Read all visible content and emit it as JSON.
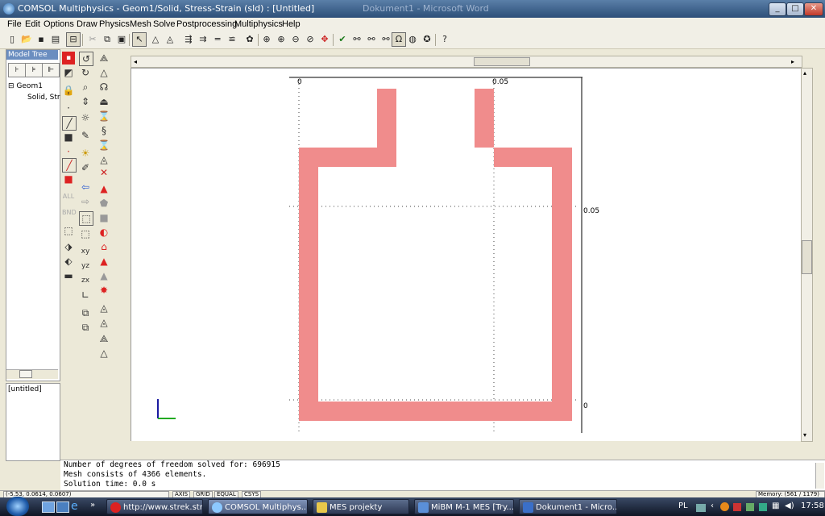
{
  "window": {
    "title": "COMSOL Multiphysics - Geom1/Solid, Stress-Strain (sld) : [Untitled]",
    "bg_title": "Dokument1 - Microsoft Word"
  },
  "menu": [
    "File",
    "Edit",
    "Options",
    "Draw",
    "Physics",
    "Mesh",
    "Solve",
    "Postprocessing",
    "Multiphysics",
    "Help"
  ],
  "model_tree": {
    "header": "Model Tree",
    "geom": "Geom1",
    "physics": "Solid, Str",
    "bottom_label": "[untitled]"
  },
  "axes": {
    "x_tick_0": "0",
    "x_tick_1": "0.05",
    "y_tick_0": "0",
    "y_tick_1": "0.05"
  },
  "geometry": {
    "color": "#f08c8c",
    "xlim": [
      0,
      0.075
    ],
    "ylim": [
      0,
      0.09
    ]
  },
  "messages": [
    "Number of degrees of freedom solved for: 696915",
    "Mesh consists of 4366 elements.",
    "Solution time: 0.0 s"
  ],
  "status": {
    "coords": "(-5.53, 0.0614, 0.0607)",
    "axis": "AXIS",
    "grid": "GRID",
    "equal": "EQUAL",
    "csys": "CSYS",
    "memory": "Memory: (561 / 1179)"
  },
  "taskbar": {
    "tasks": [
      "http://www.strek.str...",
      "COMSOL Multiphys...",
      "MES projekty",
      "MiBM M-1 MES [Try...",
      "Dokument1 - Micro..."
    ],
    "lang": "PL",
    "clock": "17:58"
  },
  "colors": {
    "shape": "#f08c8c",
    "titlebar": "#2d4f78"
  }
}
